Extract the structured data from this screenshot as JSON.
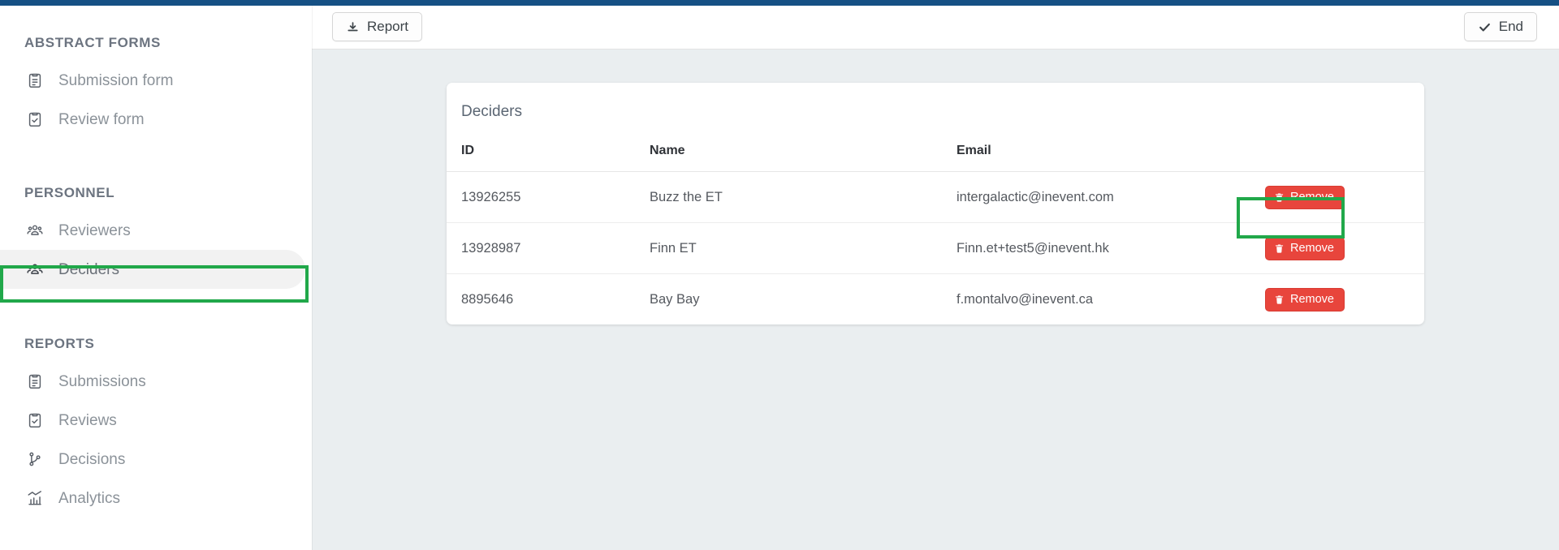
{
  "theme": {
    "accent_bar": "#155084",
    "content_bg": "#eaeef0",
    "danger": "#e8453c",
    "highlight": "#21a84a"
  },
  "toolbar": {
    "report_label": "Report",
    "report_icon": "download-icon",
    "end_label": "End",
    "end_icon": "check-icon"
  },
  "sidebar": {
    "groups": [
      {
        "title": "ABSTRACT FORMS",
        "items": [
          {
            "label": "Submission form",
            "icon": "clipboard-list-icon",
            "active": false
          },
          {
            "label": "Review form",
            "icon": "clipboard-check-icon",
            "active": false
          }
        ]
      },
      {
        "title": "PERSONNEL",
        "items": [
          {
            "label": "Reviewers",
            "icon": "users-icon",
            "active": false
          },
          {
            "label": "Deciders",
            "icon": "users-icon",
            "active": true
          }
        ]
      },
      {
        "title": "REPORTS",
        "items": [
          {
            "label": "Submissions",
            "icon": "clipboard-list-icon",
            "active": false
          },
          {
            "label": "Reviews",
            "icon": "clipboard-check-icon",
            "active": false
          },
          {
            "label": "Decisions",
            "icon": "git-branch-icon",
            "active": false
          },
          {
            "label": "Analytics",
            "icon": "chart-bar-icon",
            "active": false
          }
        ]
      }
    ]
  },
  "card": {
    "title": "Deciders",
    "columns": [
      "ID",
      "Name",
      "Email",
      ""
    ],
    "remove_label": "Remove",
    "remove_icon": "trash-icon",
    "rows": [
      {
        "id": "13926255",
        "name": "Buzz the ET",
        "email": "intergalactic@inevent.com"
      },
      {
        "id": "13928987",
        "name": "Finn ET",
        "email": "Finn.et+test5@inevent.hk"
      },
      {
        "id": "8895646",
        "name": "Bay Bay",
        "email": "f.montalvo@inevent.ca"
      }
    ]
  }
}
